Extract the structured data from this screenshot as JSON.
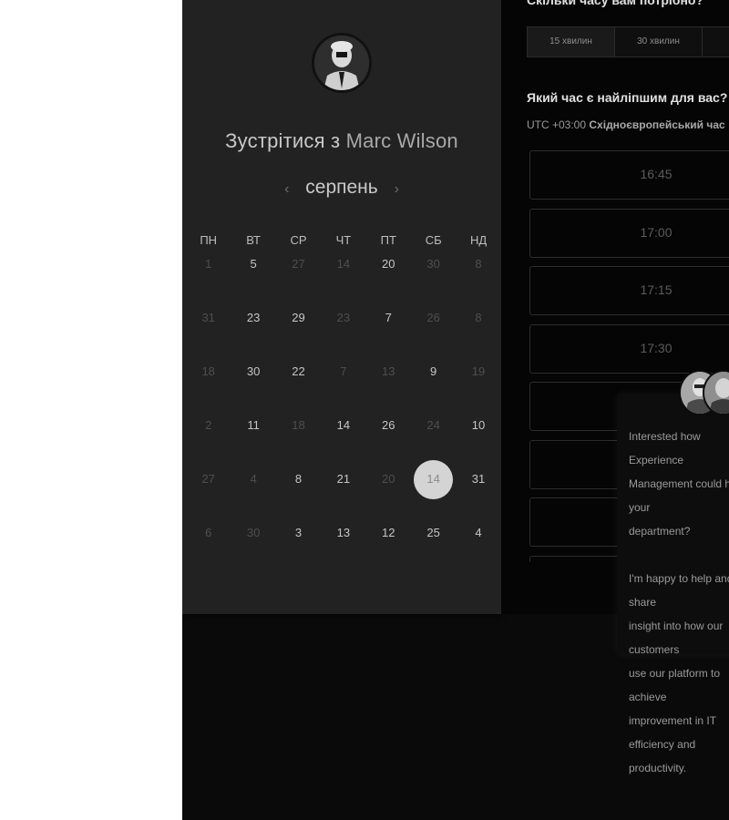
{
  "host": {
    "title_prefix": "Зустрітися з",
    "name": "Marc Wilson",
    "avatar_icon": "person-photo-icon"
  },
  "calendar": {
    "month": "серпень",
    "prev_icon": "chevron-left-icon",
    "next_icon": "chevron-right-icon",
    "weekdays": [
      "ПН",
      "ВТ",
      "СР",
      "ЧТ",
      "ПТ",
      "СБ",
      "НД"
    ],
    "weeks": [
      [
        {
          "d": "1",
          "on": false
        },
        {
          "d": "5",
          "on": true
        },
        {
          "d": "27",
          "on": false
        },
        {
          "d": "14",
          "on": false
        },
        {
          "d": "20",
          "on": true
        },
        {
          "d": "30",
          "on": false
        },
        {
          "d": "8",
          "on": false
        }
      ],
      [
        {
          "d": "31",
          "on": false
        },
        {
          "d": "23",
          "on": true
        },
        {
          "d": "29",
          "on": true
        },
        {
          "d": "23",
          "on": false
        },
        {
          "d": "7",
          "on": true
        },
        {
          "d": "26",
          "on": false
        },
        {
          "d": "8",
          "on": false
        }
      ],
      [
        {
          "d": "18",
          "on": false
        },
        {
          "d": "30",
          "on": true
        },
        {
          "d": "22",
          "on": true
        },
        {
          "d": "7",
          "on": false
        },
        {
          "d": "13",
          "on": false
        },
        {
          "d": "9",
          "on": true
        },
        {
          "d": "19",
          "on": false
        }
      ],
      [
        {
          "d": "2",
          "on": false
        },
        {
          "d": "11",
          "on": true
        },
        {
          "d": "18",
          "on": false
        },
        {
          "d": "14",
          "on": true
        },
        {
          "d": "26",
          "on": true
        },
        {
          "d": "24",
          "on": false
        },
        {
          "d": "10",
          "on": true
        }
      ],
      [
        {
          "d": "27",
          "on": false
        },
        {
          "d": "4",
          "on": false
        },
        {
          "d": "8",
          "on": true
        },
        {
          "d": "21",
          "on": true
        },
        {
          "d": "20",
          "on": false
        },
        {
          "d": "14",
          "on": true,
          "selected": true
        },
        {
          "d": "31",
          "on": true
        }
      ],
      [
        {
          "d": "6",
          "on": false
        },
        {
          "d": "30",
          "on": false
        },
        {
          "d": "3",
          "on": true
        },
        {
          "d": "13",
          "on": true
        },
        {
          "d": "12",
          "on": true
        },
        {
          "d": "25",
          "on": true
        },
        {
          "d": "4",
          "on": true
        }
      ]
    ]
  },
  "duration": {
    "heading": "Скільки часу вам потрібно?",
    "options": [
      "15 хвилин",
      "30 хвилин",
      ""
    ],
    "selected": "15 хвилин"
  },
  "times": {
    "heading": "Який час є найліпшим для вас?",
    "tz_offset": "UTC +03:00",
    "tz_name": "Східноєвропейський час",
    "slots": [
      "16:45",
      "17:00",
      "17:15",
      "17:30",
      "",
      "",
      "",
      ""
    ]
  },
  "chat": {
    "message": "Interested how Experience\nManagement could help your\ndepartment?\n\nI'm happy to help and share\ninsight into how our customers\nuse our platform to achieve\nimprovement in IT efficiency and\nproductivity.",
    "avatar_icons": [
      "agent-avatar-icon",
      "agent-avatar-icon"
    ]
  },
  "colors": {
    "page_bg": "#ffffff",
    "app_bg": "#0a0a0a",
    "left_panel_bg": "#222222",
    "selected_day_bg": "#d4d4d4"
  }
}
